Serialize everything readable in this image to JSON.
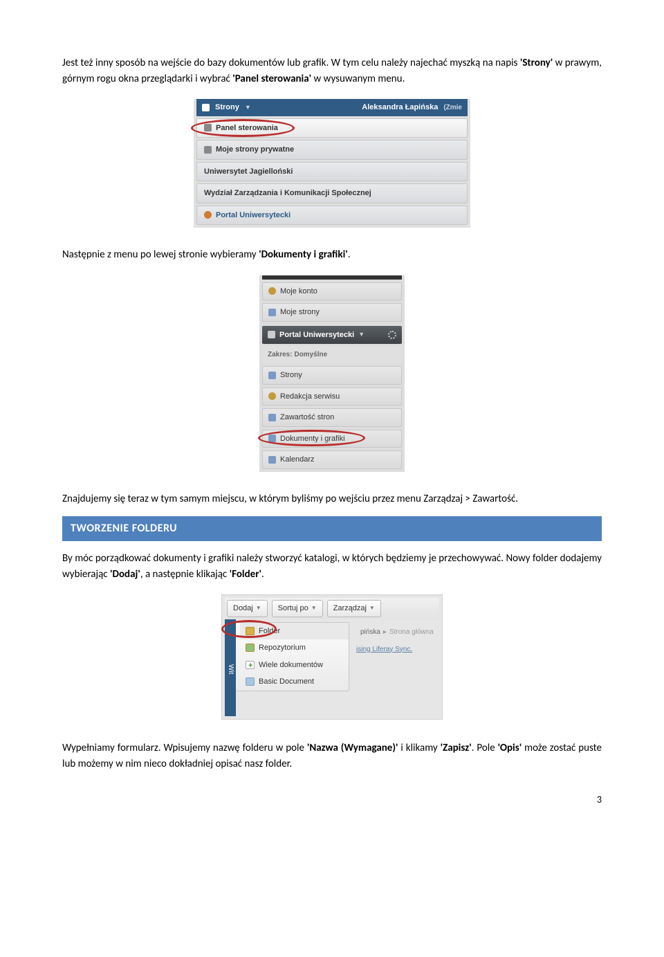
{
  "para1_a": "Jest też inny sposób na wejście do bazy dokumentów lub grafik. W tym celu należy najechać myszką na napis ",
  "para1_b": "'Strony'",
  "para1_c": " w prawym, górnym rogu okna przeglądarki i wybrać ",
  "para1_d": "'Panel sterowania'",
  "para1_e": " w wysuwanym menu.",
  "fig1": {
    "home": "Strony",
    "user": "Aleksandra Łapińska",
    "role": "(Zmie",
    "rows": [
      "Panel sterowania",
      "Moje strony prywatne",
      "Uniwersytet Jagielloński",
      "Wydział Zarządzania i Komunikacji Społecznej",
      "Portal Uniwersytecki"
    ]
  },
  "para2_a": "Następnie z menu po lewej stronie wybieramy ",
  "para2_b": "'Dokumenty i grafiki'",
  "para2_c": ".",
  "fig2": {
    "top_items": [
      "Moje konto",
      "Moje strony"
    ],
    "header": "Portal Uniwersytecki",
    "sub": "Zakres: Domyślne",
    "items": [
      "Strony",
      "Redakcja serwisu",
      "Zawartość stron",
      "Dokumenty i grafiki",
      "Kalendarz"
    ]
  },
  "para3": "Znajdujemy się teraz w tym samym miejscu, w którym byliśmy po wejściu przez menu Zarządzaj > Zawartość.",
  "heading": "TWORZENIE FOLDERU",
  "para4_a": "By móc porządkować dokumenty i grafiki należy stworzyć katalogi, w których będziemy je przechowywać. Nowy folder dodajemy wybierając ",
  "para4_b": "'Dodaj'",
  "para4_c": ", a następnie klikając ",
  "para4_d": "'Folder'",
  "para4_e": ".",
  "fig3": {
    "btns": [
      "Dodaj",
      "Sortuj po",
      "Zarządzaj"
    ],
    "left": "Wit",
    "dropdown": [
      "Folder",
      "Repozytorium",
      "Wiele dokumentów",
      "Basic Document"
    ],
    "crumb_dark": "pińska",
    "crumb_light": "Strona główna",
    "sync": "ising Liferay Sync."
  },
  "para5_a": "Wypełniamy formularz. Wpisujemy nazwę folderu w pole ",
  "para5_b": "'Nazwa (Wymagane)'",
  "para5_c": " i klikamy ",
  "para5_d": "'Zapisz'",
  "para5_e": ". Pole ",
  "para5_f": "'Opis'",
  "para5_g": " może zostać puste lub możemy w nim nieco dokładniej opisać nasz folder.",
  "page_number": "3"
}
